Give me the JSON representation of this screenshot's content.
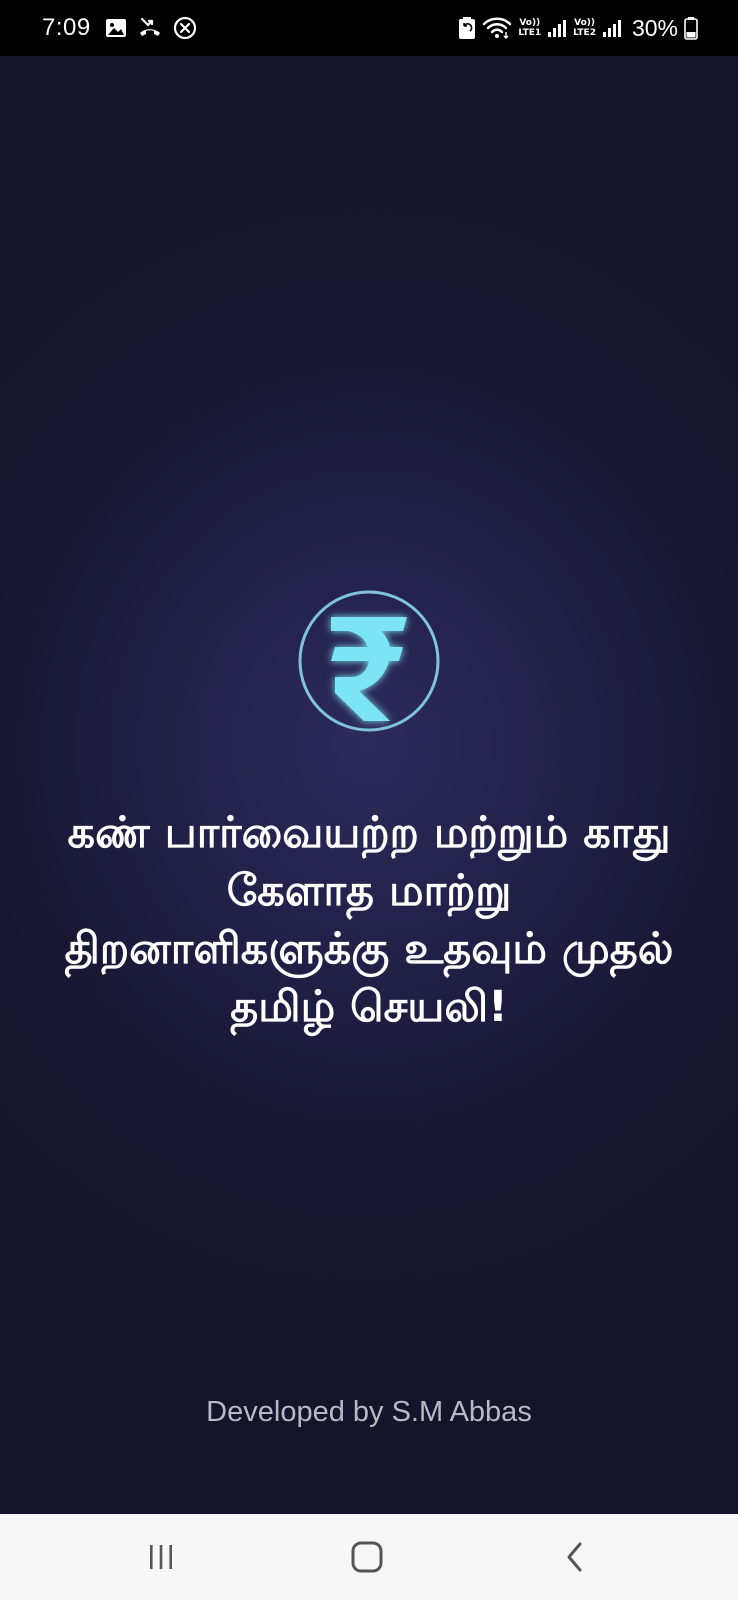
{
  "status_bar": {
    "time": "7:09",
    "left_icons": [
      "gallery-icon",
      "missed-call-icon",
      "blocked-icon"
    ],
    "right_icons": [
      "battery-saver-icon",
      "wifi-icon",
      "signal-sim1-icon",
      "signal-sim2-icon",
      "battery-icon"
    ],
    "sim1_top": "Vo))",
    "sim1_bottom": "LTE1",
    "sim2_top": "Vo))",
    "sim2_bottom": "LTE2",
    "battery_percent": "30%"
  },
  "splash": {
    "logo_icon": "rupee-icon",
    "accent_color": "#6fe6f5",
    "tagline": "கண் பார்வையற்ற மற்றும் காது கேளாத மாற்று திறனாளிகளுக்கு உதவும் முதல் தமிழ் செயலி!",
    "developer_credit": "Developed by S.M Abbas"
  },
  "nav_bar": {
    "recents_icon": "recents-icon",
    "home_icon": "home-icon",
    "back_icon": "back-icon"
  }
}
